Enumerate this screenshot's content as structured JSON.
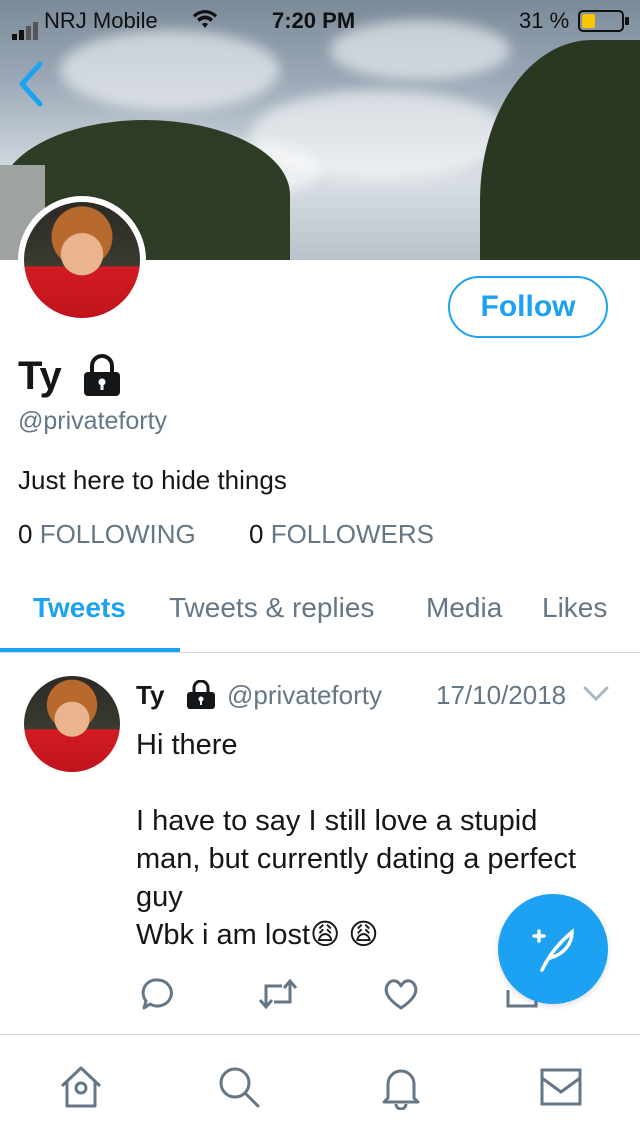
{
  "status_bar": {
    "carrier": "NRJ Mobile",
    "time": "7:20 PM",
    "battery": "31 %"
  },
  "profile": {
    "name": "Ty",
    "handle": "@privateforty",
    "bio": "Just here to hide things",
    "following_count": "0",
    "following_label": "FOLLOWING",
    "followers_count": "0",
    "followers_label": "FOLLOWERS",
    "follow_button": "Follow"
  },
  "tabs": [
    {
      "label": "Tweets",
      "active": true
    },
    {
      "label": "Tweets & replies",
      "active": false
    },
    {
      "label": "Media",
      "active": false
    },
    {
      "label": "Likes",
      "active": false
    }
  ],
  "tweet": {
    "name": "Ty",
    "handle": "@privateforty",
    "date": "17/10/2018",
    "text": "Hi there\n\nI have to say I still love a stupid man, but currently dating a perfect guy\nWbk i am lost😩 😩"
  },
  "icons": {
    "back": "chevron-left-icon",
    "lock": "lock-icon",
    "compose": "compose-tweet-icon",
    "nav": [
      "home-icon",
      "search-icon",
      "notifications-icon",
      "messages-icon"
    ],
    "actions": [
      "reply-icon",
      "retweet-icon",
      "like-icon",
      "share-icon"
    ]
  },
  "colors": {
    "accent": "#1da1f2",
    "secondary_text": "#657786"
  }
}
